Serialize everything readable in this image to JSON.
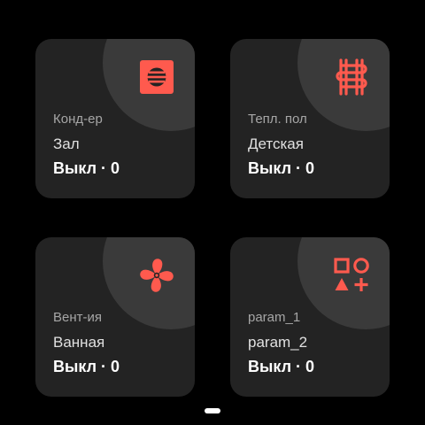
{
  "accent_color": "#ff5a4e",
  "tiles": [
    {
      "icon": "ac-unit-icon",
      "category": "Конд-ер",
      "room": "Зал",
      "status": "Выкл · 0"
    },
    {
      "icon": "floor-heating-icon",
      "category": "Тепл. пол",
      "room": "Детская",
      "status": "Выкл · 0"
    },
    {
      "icon": "fan-icon",
      "category": "Вент-ия",
      "room": "Ванная",
      "status": "Выкл · 0"
    },
    {
      "icon": "shapes-icon",
      "category": "param_1",
      "room": "param_2",
      "status": "Выкл · 0"
    }
  ],
  "pager": {
    "page_count": 1,
    "current_page": 1
  }
}
